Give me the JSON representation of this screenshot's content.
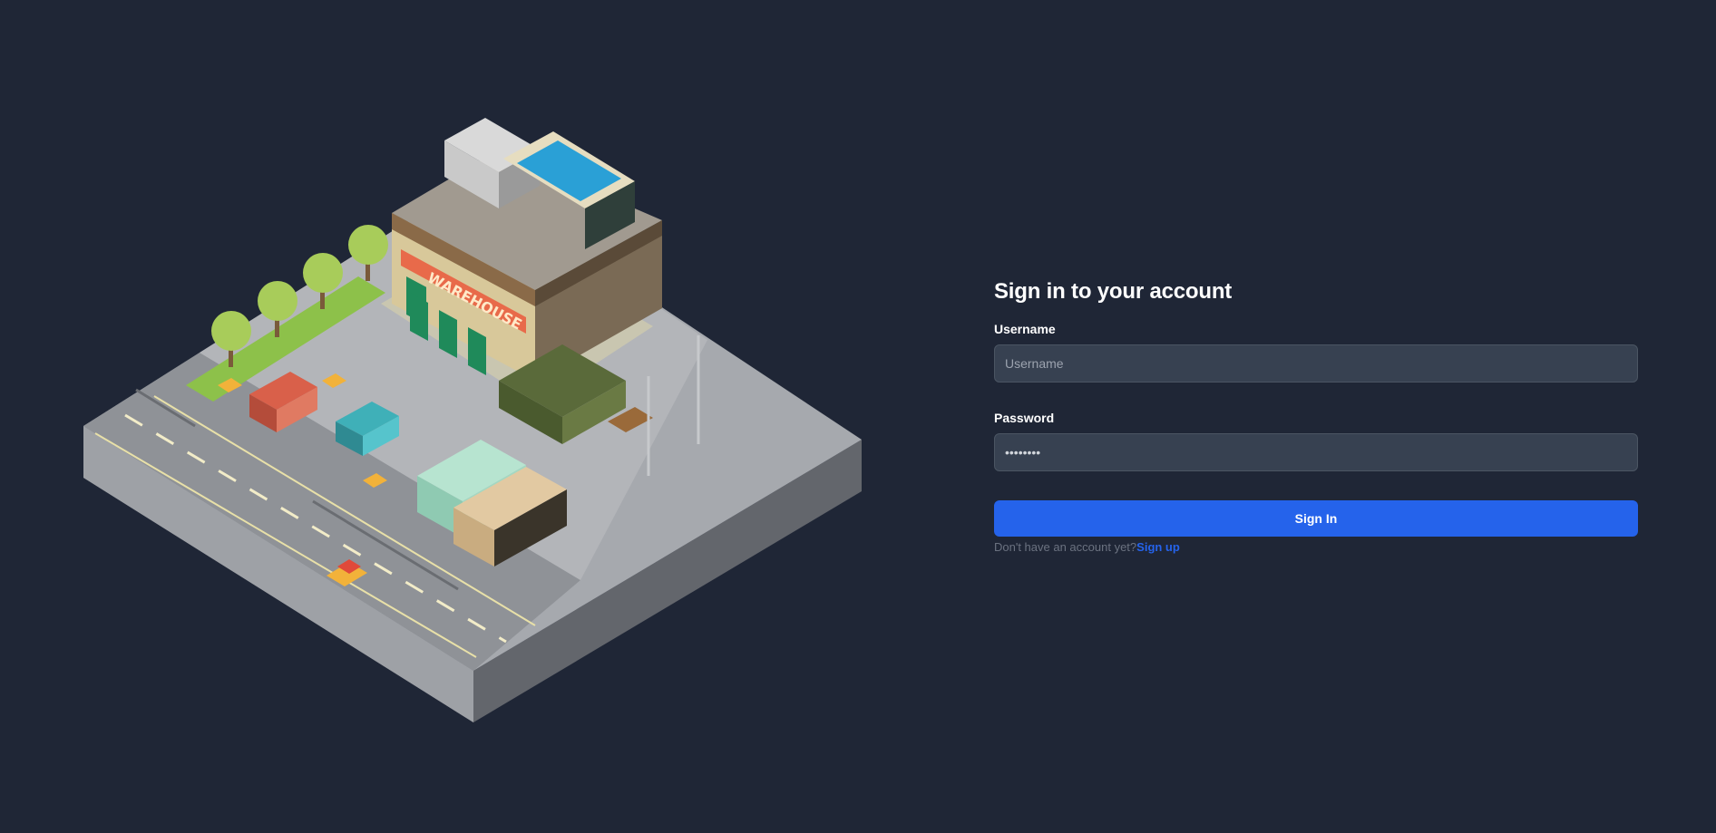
{
  "login": {
    "title": "Sign in to your account",
    "username_label": "Username",
    "username_placeholder": "Username",
    "username_value": "",
    "password_label": "Password",
    "password_value": "••••••••",
    "submit_label": "Sign In",
    "signup_prompt": "Don't have an account yet?",
    "signup_link": "Sign up",
    "accent_color": "#2563eb"
  },
  "illustration": {
    "building_sign": "WAREHOUSE",
    "icon": "isometric-warehouse-illustration"
  },
  "colors": {
    "background": "#1f2636",
    "input_background": "#374151",
    "input_border": "#4b5563",
    "text_primary": "#ffffff",
    "text_muted": "#6b7280"
  }
}
